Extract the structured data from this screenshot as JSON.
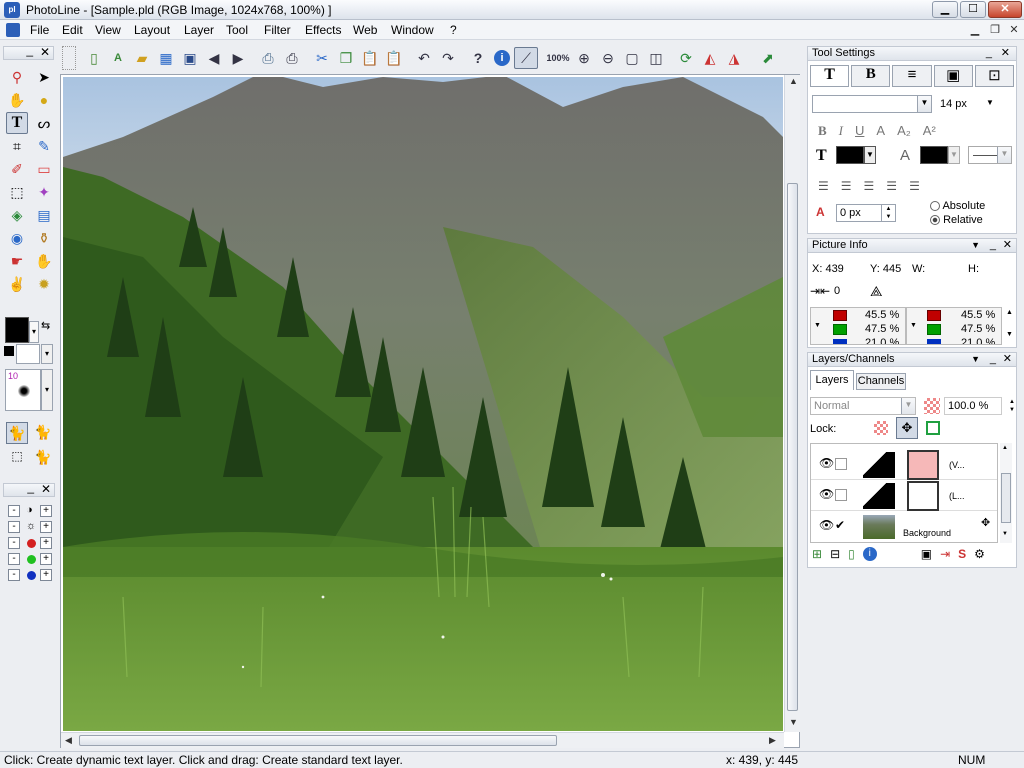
{
  "window": {
    "title": "PhotoLine - [Sample.pld  (RGB Image, 1024x768, 100%) ]",
    "app_icon_text": "pl",
    "controls": [
      "minimize",
      "maximize",
      "close"
    ]
  },
  "menubar": {
    "items": [
      "File",
      "Edit",
      "View",
      "Layout",
      "Layer",
      "Tool",
      "Filter",
      "Effects",
      "Web",
      "Window",
      "?"
    ]
  },
  "toolbar": {
    "zoom_label": "100%",
    "icons": [
      "new-doc-icon",
      "new-text-doc-icon",
      "open-icon",
      "scan-icon",
      "save-icon",
      "back-icon",
      "forward-icon",
      "print-preview-icon",
      "print-icon",
      "cut-icon",
      "copy-icon",
      "paste-icon",
      "paste-new-icon",
      "undo-icon",
      "redo-icon",
      "help-icon",
      "info-icon",
      "line-tool-icon"
    ]
  },
  "left_panel": {
    "brush_size_label": "10",
    "tools": [
      "zoom-icon",
      "arrow-select-icon",
      "hand-icon",
      "ellipse-icon",
      "text-tool-icon",
      "lasso-icon",
      "crop-icon",
      "eyedropper-icon",
      "brush-icon",
      "eraser-icon",
      "rect-select-icon",
      "magic-wand-icon",
      "fill-icon",
      "gradient-icon",
      "sponge-icon",
      "stamp-icon",
      "smudge-icon",
      "burn-icon",
      "retouch-icon",
      "sharpen-icon"
    ],
    "adjust_rows": [
      {
        "symbol": "◑",
        "color": ""
      },
      {
        "symbol": "☼",
        "color": ""
      },
      {
        "symbol": "",
        "color": "#d42020"
      },
      {
        "symbol": "",
        "color": "#20c020"
      },
      {
        "symbol": "",
        "color": "#1030c0"
      }
    ],
    "foreground_color": "#000000",
    "background_color": "#ffffff"
  },
  "tool_settings": {
    "title": "Tool Settings",
    "tabs": [
      "T",
      "B",
      "≡",
      "▣",
      "⊡"
    ],
    "font_size": "14 px",
    "font_name": "",
    "style_buttons": [
      "B",
      "I",
      "U",
      "A",
      "A₂",
      "A²"
    ],
    "fill_color": "#000000",
    "stroke_color": "#000000",
    "baseline_value": "0 px",
    "radio_absolute": "Absolute",
    "radio_relative": "Relative",
    "selected_mode": "Relative"
  },
  "picture_info": {
    "title": "Picture Info",
    "x_label": "X: 439",
    "y_label": "Y: 445",
    "w_label": "W:",
    "h_label": "H:",
    "distance_value": "0",
    "left_values": [
      "45.5 %",
      "47.5 %",
      "21.0 %"
    ],
    "right_values": [
      "45.5 %",
      "47.5 %",
      "21.0 %"
    ]
  },
  "layers": {
    "title": "Layers/Channels",
    "tabs": [
      "Layers",
      "Channels"
    ],
    "active_tab": "Layers",
    "blend_mode": "Normal",
    "opacity": "100.0 %",
    "lock_label": "Lock:",
    "rows": [
      {
        "name": "(V...",
        "checked": false
      },
      {
        "name": "(L...",
        "checked": false
      },
      {
        "name": "Background",
        "checked": true
      }
    ]
  },
  "status": {
    "hint": "Click: Create dynamic text layer. Click and drag: Create standard text layer.",
    "coords": "x: 439, y: 445",
    "num": "NUM"
  },
  "colors": {
    "accent": "#2c5fb8",
    "titlebar_close": "#c7452c"
  }
}
